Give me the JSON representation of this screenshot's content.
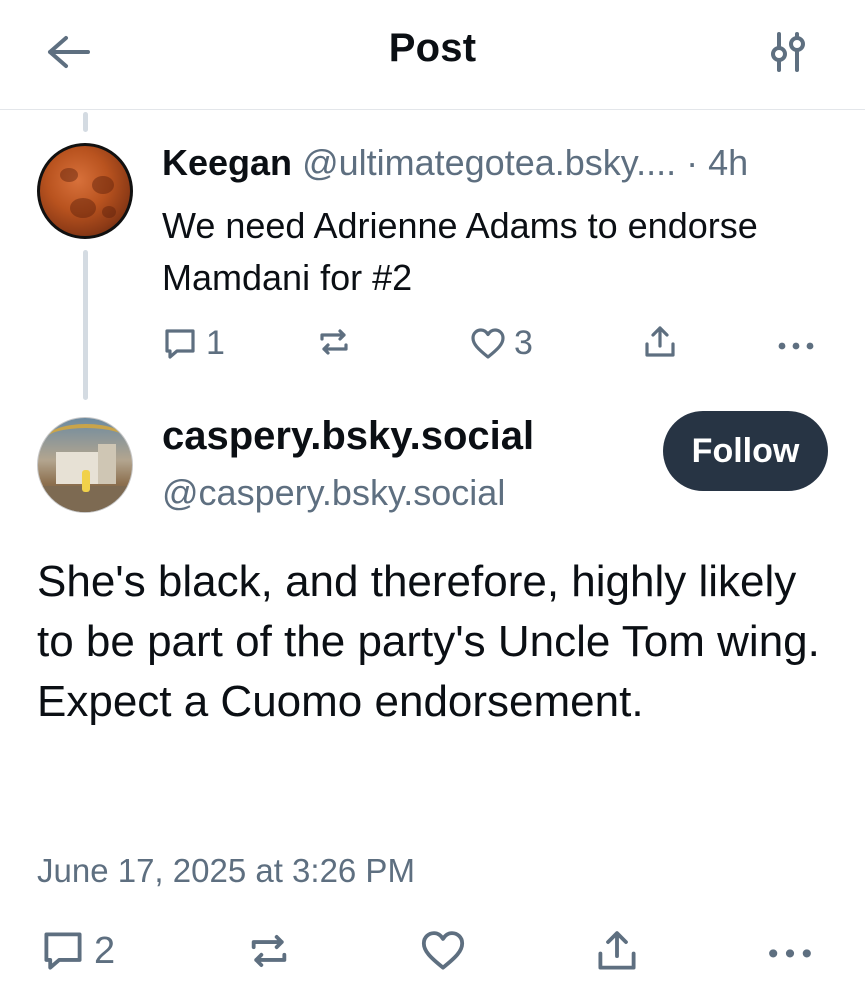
{
  "header": {
    "title": "Post",
    "back_icon": "arrow-left-icon",
    "settings_icon": "sliders-icon"
  },
  "parent_post": {
    "author_name": "Keegan",
    "author_handle": "@ultimategotea.bsky....",
    "separator": "·",
    "time_ago": "4h",
    "text": "We need Adrienne Adams to endorse Mamdani for #2",
    "reply_count": "1",
    "repost_count": "",
    "like_count": "3",
    "avatar_icon": "blood-moon-avatar"
  },
  "main_post": {
    "author_name": "caspery.bsky.social",
    "author_handle": "@caspery.bsky.social",
    "follow_label": "Follow",
    "text": "She's black, and therefore, highly likely to be part of the party's Uncle Tom wing. Expect a Cuomo endorsement.",
    "timestamp": "June 17, 2025 at 3:26 PM",
    "reply_count": "2",
    "repost_count": "",
    "like_count": ""
  },
  "colors": {
    "text_primary": "#0b0f14",
    "text_secondary": "#5e6f80",
    "follow_bg": "#273444",
    "thread_line": "#d4dbe2",
    "divider": "#e3e6ea"
  }
}
